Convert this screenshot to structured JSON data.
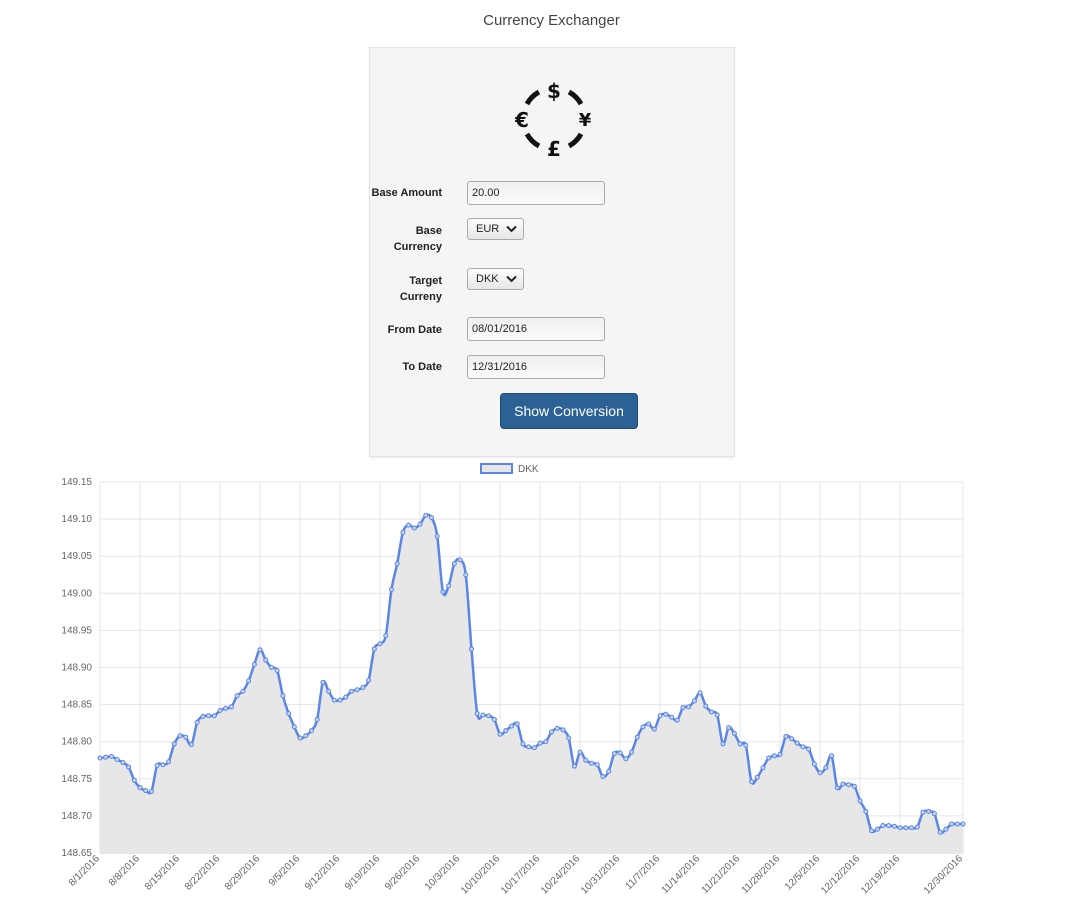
{
  "app": {
    "title": "Currency Exchanger"
  },
  "form": {
    "base_amount_label": "Base Amount",
    "base_amount_value": "20.00",
    "base_currency_label_1": "Base",
    "base_currency_label_2": "Currency",
    "base_currency_value": "EUR",
    "target_currency_label_1": "Target",
    "target_currency_label_2": "Curreny",
    "target_currency_value": "DKK",
    "from_date_label": "From Date",
    "from_date_value": "08/01/2016",
    "to_date_label": "To Date",
    "to_date_value": "12/31/2016",
    "submit_label": "Show Conversion"
  },
  "logo": {
    "icon": "currency-exchange-icon",
    "symbols": [
      "$",
      "€",
      "¥",
      "£"
    ]
  },
  "colors": {
    "accent": "#2b6194",
    "line": "#5b86e5",
    "fill": "#e6e6e6"
  },
  "chart_data": {
    "type": "area",
    "series": [
      {
        "name": "DKK"
      }
    ],
    "ylim": [
      148.65,
      149.15
    ],
    "yticks": [
      "149.15",
      "149.10",
      "149.05",
      "149.00",
      "148.95",
      "148.90",
      "148.85",
      "148.80",
      "148.75",
      "148.70",
      "148.65"
    ],
    "xticks": [
      "8/1/2016",
      "8/8/2016",
      "8/15/2016",
      "8/22/2016",
      "8/29/2016",
      "9/5/2016",
      "9/12/2016",
      "9/19/2016",
      "9/26/2016",
      "10/3/2016",
      "10/10/2016",
      "10/17/2016",
      "10/24/2016",
      "10/31/2016",
      "11/7/2016",
      "11/14/2016",
      "11/21/2016",
      "11/28/2016",
      "12/5/2016",
      "12/12/2016",
      "12/19/2016",
      "12/30/2016"
    ],
    "xtick_day_index": [
      0,
      7,
      14,
      21,
      28,
      35,
      42,
      49,
      56,
      63,
      70,
      77,
      84,
      91,
      98,
      105,
      112,
      119,
      126,
      133,
      140,
      151
    ],
    "x_days": 152,
    "points": [
      [
        0,
        148.778
      ],
      [
        1,
        148.779
      ],
      [
        2,
        148.78
      ],
      [
        3,
        148.776
      ],
      [
        4,
        148.772
      ],
      [
        5,
        148.766
      ],
      [
        6,
        148.748
      ],
      [
        7,
        148.738
      ],
      [
        8,
        148.734
      ],
      [
        9,
        148.733
      ],
      [
        10,
        148.768
      ],
      [
        11,
        148.769
      ],
      [
        12,
        148.773
      ],
      [
        13,
        148.797
      ],
      [
        14,
        148.808
      ],
      [
        15,
        148.806
      ],
      [
        16,
        148.796
      ],
      [
        17,
        148.826
      ],
      [
        18,
        148.834
      ],
      [
        19,
        148.835
      ],
      [
        20,
        148.835
      ],
      [
        21,
        148.842
      ],
      [
        22,
        148.845
      ],
      [
        23,
        148.847
      ],
      [
        24,
        148.862
      ],
      [
        25,
        148.868
      ],
      [
        26,
        148.882
      ],
      [
        27,
        148.904
      ],
      [
        28,
        148.924
      ],
      [
        29,
        148.91
      ],
      [
        30,
        148.9
      ],
      [
        31,
        148.896
      ],
      [
        32,
        148.862
      ],
      [
        33,
        148.838
      ],
      [
        34,
        148.82
      ],
      [
        35,
        148.805
      ],
      [
        36,
        148.808
      ],
      [
        37,
        148.815
      ],
      [
        38,
        148.83
      ],
      [
        39,
        148.88
      ],
      [
        40,
        148.868
      ],
      [
        41,
        148.856
      ],
      [
        42,
        148.856
      ],
      [
        43,
        148.86
      ],
      [
        44,
        148.868
      ],
      [
        45,
        148.87
      ],
      [
        46,
        148.873
      ],
      [
        47,
        148.883
      ],
      [
        48,
        148.925
      ],
      [
        49,
        148.932
      ],
      [
        50,
        148.943
      ],
      [
        51,
        149.005
      ],
      [
        52,
        149.04
      ],
      [
        53,
        149.082
      ],
      [
        54,
        149.092
      ],
      [
        55,
        149.088
      ],
      [
        56,
        149.093
      ],
      [
        57,
        149.105
      ],
      [
        58,
        149.102
      ],
      [
        59,
        149.077
      ],
      [
        60,
        149.002
      ],
      [
        61,
        149.01
      ],
      [
        62,
        149.04
      ],
      [
        63,
        149.045
      ],
      [
        64,
        149.025
      ],
      [
        65,
        148.925
      ],
      [
        66,
        148.838
      ],
      [
        67,
        148.836
      ],
      [
        68,
        148.835
      ],
      [
        69,
        148.83
      ],
      [
        70,
        148.81
      ],
      [
        71,
        148.815
      ],
      [
        72,
        148.821
      ],
      [
        73,
        148.824
      ],
      [
        74,
        148.797
      ],
      [
        75,
        148.793
      ],
      [
        76,
        148.792
      ],
      [
        77,
        148.798
      ],
      [
        78,
        148.8
      ],
      [
        79,
        148.813
      ],
      [
        80,
        148.818
      ],
      [
        81,
        148.816
      ],
      [
        82,
        148.805
      ],
      [
        83,
        148.767
      ],
      [
        84,
        148.786
      ],
      [
        85,
        148.775
      ],
      [
        86,
        148.771
      ],
      [
        87,
        148.769
      ],
      [
        88,
        148.753
      ],
      [
        89,
        148.76
      ],
      [
        90,
        148.784
      ],
      [
        91,
        148.785
      ],
      [
        92,
        148.777
      ],
      [
        93,
        148.786
      ],
      [
        94,
        148.806
      ],
      [
        95,
        148.82
      ],
      [
        96,
        148.824
      ],
      [
        97,
        148.817
      ],
      [
        98,
        148.835
      ],
      [
        99,
        148.837
      ],
      [
        100,
        148.833
      ],
      [
        101,
        148.829
      ],
      [
        102,
        148.846
      ],
      [
        103,
        148.847
      ],
      [
        104,
        148.855
      ],
      [
        105,
        148.866
      ],
      [
        106,
        148.848
      ],
      [
        107,
        148.84
      ],
      [
        108,
        148.836
      ],
      [
        109,
        148.797
      ],
      [
        110,
        148.819
      ],
      [
        111,
        148.811
      ],
      [
        112,
        148.797
      ],
      [
        113,
        148.795
      ],
      [
        114,
        148.746
      ],
      [
        115,
        148.752
      ],
      [
        116,
        148.765
      ],
      [
        117,
        148.778
      ],
      [
        118,
        148.781
      ],
      [
        119,
        148.783
      ],
      [
        120,
        148.807
      ],
      [
        121,
        148.804
      ],
      [
        122,
        148.798
      ],
      [
        123,
        148.793
      ],
      [
        124,
        148.79
      ],
      [
        125,
        148.77
      ],
      [
        126,
        148.758
      ],
      [
        127,
        148.765
      ],
      [
        128,
        148.781
      ],
      [
        129,
        148.738
      ],
      [
        130,
        148.743
      ],
      [
        131,
        148.742
      ],
      [
        132,
        148.74
      ],
      [
        133,
        148.72
      ],
      [
        134,
        148.706
      ],
      [
        135,
        148.68
      ],
      [
        136,
        148.682
      ],
      [
        137,
        148.687
      ],
      [
        138,
        148.687
      ],
      [
        139,
        148.686
      ],
      [
        140,
        148.684
      ],
      [
        141,
        148.684
      ],
      [
        142,
        148.684
      ],
      [
        143,
        148.685
      ],
      [
        144,
        148.705
      ],
      [
        145,
        148.706
      ],
      [
        146,
        148.703
      ],
      [
        147,
        148.678
      ],
      [
        148,
        148.682
      ],
      [
        149,
        148.689
      ],
      [
        150,
        148.689
      ],
      [
        151,
        148.689
      ]
    ]
  }
}
